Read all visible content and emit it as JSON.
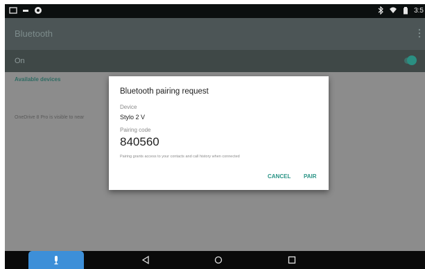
{
  "status_bar": {
    "time": "3:5"
  },
  "app_bar": {
    "title": "Bluetooth"
  },
  "toggle_row": {
    "label": "On",
    "enabled": true
  },
  "list": {
    "section_header": "Available devices",
    "visibility_text": "OneDrive 8 Pro is visible to near"
  },
  "dialog": {
    "title": "Bluetooth pairing request",
    "device_label": "Device",
    "device_name": "Stylo 2 V",
    "code_label": "Pairing code",
    "code": "840560",
    "note": "Pairing grants access to your contacts and call history when connected",
    "cancel_label": "CANCEL",
    "pair_label": "PAIR"
  },
  "colors": {
    "accent": "#2a9486",
    "status_bar": "#0b0f0f",
    "nav_bar": "#0a0a0a",
    "mic_tab": "#3d8fd8"
  }
}
